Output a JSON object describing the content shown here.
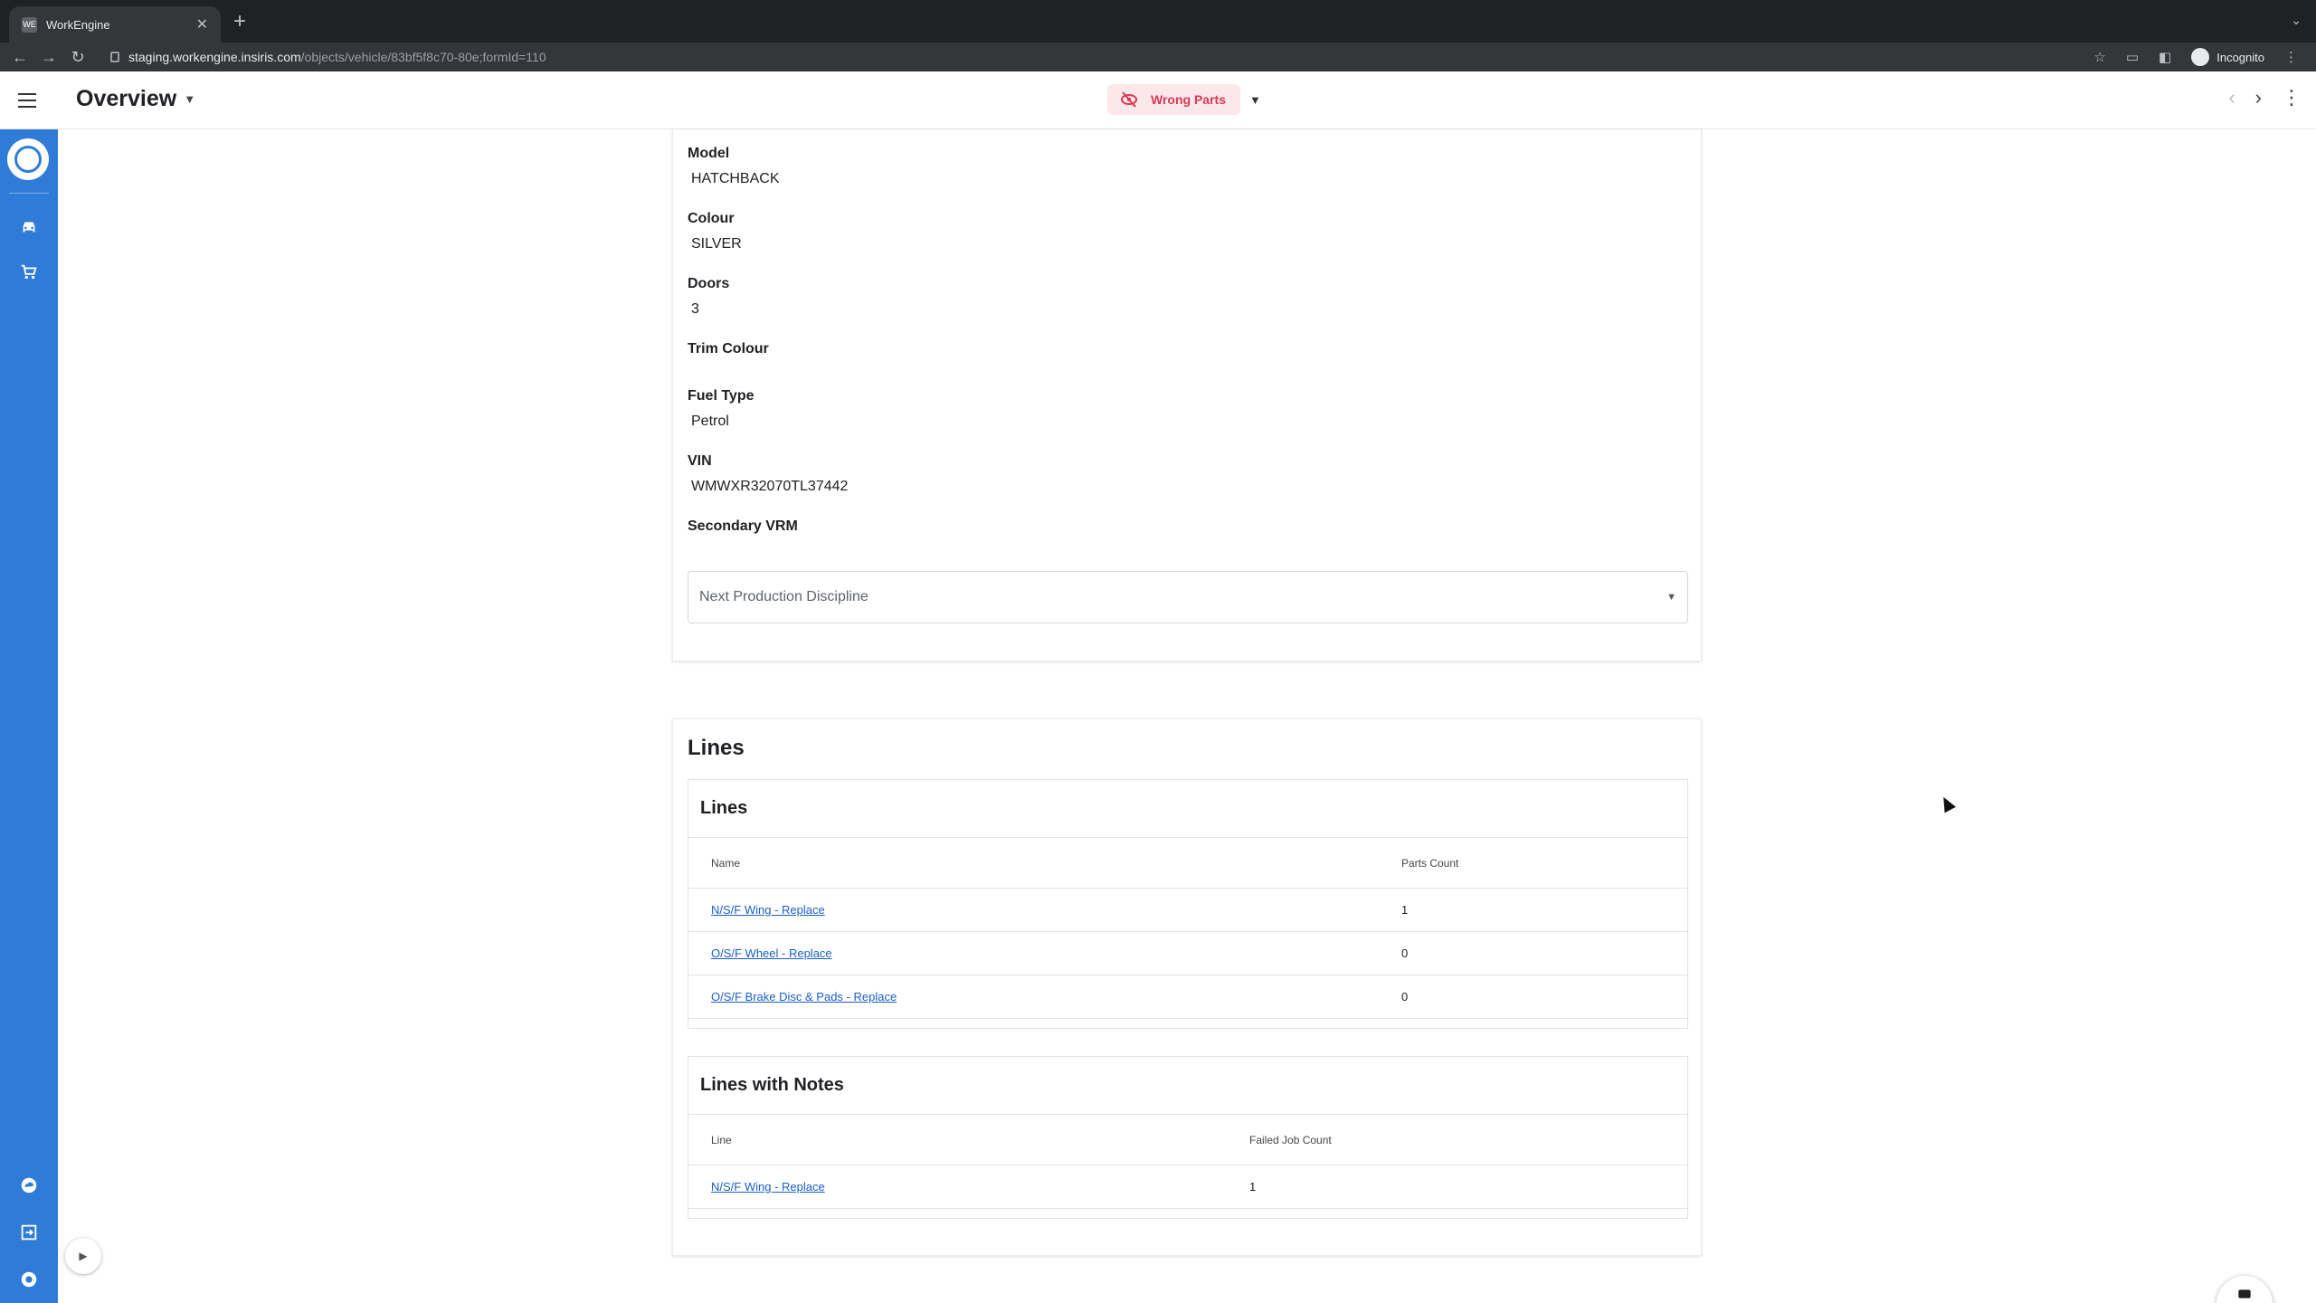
{
  "browser": {
    "tab_title": "WorkEngine",
    "tab_favicon": "WE",
    "url_host": "staging.workengine.insiris.com",
    "url_path": "/objects/vehicle/83bf5f8c70-80e;formId=110",
    "profile_label": "Incognito"
  },
  "header": {
    "title": "Overview",
    "status_label": "Wrong Parts",
    "status_color": "#d93a57"
  },
  "sidebar": {
    "accent": "#2f7cd8",
    "top_icons": [
      "car-icon",
      "cart-icon"
    ],
    "bottom_icons": [
      "cloud-icon",
      "logout-icon",
      "help-icon"
    ]
  },
  "details": {
    "fields": [
      {
        "label": "Model",
        "value": "HATCHBACK"
      },
      {
        "label": "Colour",
        "value": "SILVER"
      },
      {
        "label": "Doors",
        "value": "3"
      },
      {
        "label": "Trim Colour",
        "value": ""
      },
      {
        "label": "Fuel Type",
        "value": "Petrol"
      },
      {
        "label": "VIN",
        "value": "WMWXR32070TL37442"
      },
      {
        "label": "Secondary VRM",
        "value": ""
      }
    ],
    "select_placeholder": "Next Production Discipline"
  },
  "lines_section": {
    "title": "Lines",
    "lines_table": {
      "title": "Lines",
      "columns": [
        "Name",
        "Parts Count"
      ],
      "rows": [
        {
          "name": "N/S/F Wing - Replace",
          "count": "1"
        },
        {
          "name": "O/S/F Wheel - Replace",
          "count": "0"
        },
        {
          "name": "O/S/F Brake Disc & Pads - Replace",
          "count": "0"
        }
      ]
    },
    "notes_table": {
      "title": "Lines with Notes",
      "columns": [
        "Line",
        "Failed Job Count"
      ],
      "rows": [
        {
          "name": "N/S/F Wing - Replace",
          "count": "1"
        }
      ]
    }
  }
}
